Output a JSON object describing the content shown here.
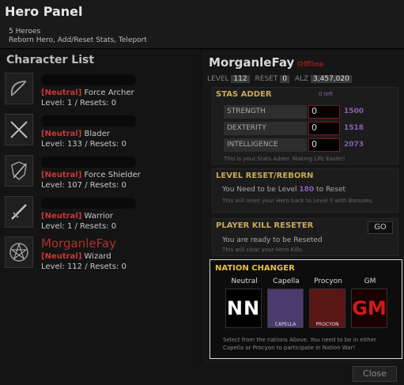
{
  "header": {
    "title": "Hero Panel",
    "line1": "5 Heroes",
    "line2": "Reborn Hero, Add/Reset Stats, Teleport"
  },
  "list_title": "Character List",
  "characters": [
    {
      "name": "",
      "faction": "Neutral",
      "cls": "Force Archer",
      "level": "Level: 1 / Resets: 0"
    },
    {
      "name": "",
      "faction": "Neutral",
      "cls": "Blader",
      "level": "Level: 133 / Resets: 0"
    },
    {
      "name": "",
      "faction": "Neutral",
      "cls": "Force Shielder",
      "level": "Level: 107 / Resets: 0"
    },
    {
      "name": "",
      "faction": "Neutral",
      "cls": "Warrior",
      "level": "Level: 1 / Resets: 0"
    },
    {
      "name": "MorganleFay",
      "faction": "Neutral",
      "cls": "Wizard",
      "level": "Level: 112 / Resets: 0"
    }
  ],
  "selected": {
    "name": "MorganleFay",
    "status": "Offline",
    "level_label": "LEVEL",
    "level": "112",
    "reset_label": "RESET",
    "reset": "0",
    "alz_label": "ALZ",
    "alz": "3,457,020"
  },
  "stats_adder": {
    "title": "STAS ADDER",
    "left": "0 left",
    "rows": [
      {
        "label": "STRENGTH",
        "value": "0",
        "max": "1500"
      },
      {
        "label": "DEXTERITY",
        "value": "0",
        "max": "1518"
      },
      {
        "label": "INTELLIGENCE",
        "value": "0",
        "max": "2073"
      }
    ],
    "note": "This is your Stats Adder. Making Life Easier!"
  },
  "level_reset": {
    "title": "LEVEL RESET/REBORN",
    "msg1": "You Need to be Level ",
    "level": "180",
    "msg2": " to Reset",
    "note": "This will reset your Hero back to Level 0 with Bonuses."
  },
  "pk_reset": {
    "title": "PLAYER KILL RESETER",
    "msg": "You are ready to be Reseted",
    "go": "GO",
    "note": "This will clear your Hero Kills."
  },
  "nation": {
    "title": "NATION CHANGER",
    "options": [
      {
        "label": "Neutral",
        "img": "NN"
      },
      {
        "label": "Capella",
        "img": "CAPELLA"
      },
      {
        "label": "Procyon",
        "img": "PROCYON"
      },
      {
        "label": "GM",
        "img": "GM"
      }
    ],
    "note": "Select from the nations Above. You need to be in either Capella or Procyon to participate in Nation War!"
  },
  "close": "Close",
  "colors": {
    "accent": "#c93636",
    "gold": "#e6c23a",
    "purple": "#8a5fb3"
  }
}
